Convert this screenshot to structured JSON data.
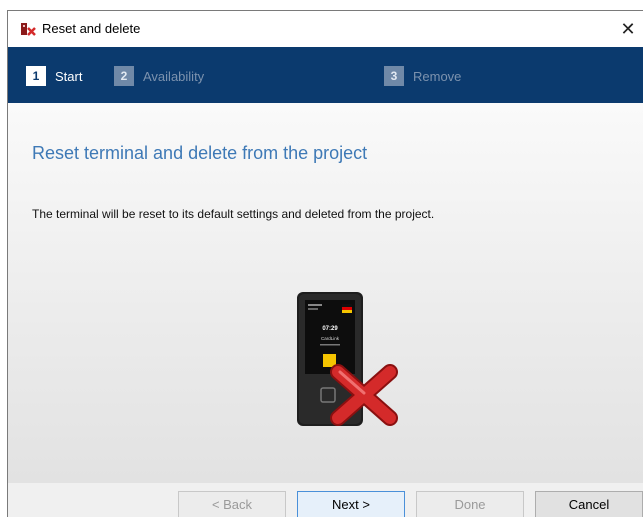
{
  "window": {
    "title": "Reset and delete",
    "close_glyph": "✕"
  },
  "steps": [
    {
      "number": "1",
      "label": "Start",
      "state": "active"
    },
    {
      "number": "2",
      "label": "Availability",
      "state": "inactive"
    },
    {
      "number": "3",
      "label": "Remove",
      "state": "inactive"
    }
  ],
  "content": {
    "heading": "Reset terminal and delete from the project",
    "description": "The terminal will be reset to its default settings and deleted from the project.",
    "device_screen": {
      "time": "07:29",
      "brand": "CardLink"
    },
    "illustration_icons": [
      "terminal-device-icon",
      "red-cross-delete-icon"
    ]
  },
  "footer": {
    "back_label": "< Back",
    "next_label": "Next >",
    "done_label": "Done",
    "cancel_label": "Cancel"
  },
  "colors": {
    "step_bar": "#0b3a6e",
    "heading": "#3e79b6",
    "delete_cross": "#d42a2a",
    "device_accent": "#f5c400"
  }
}
